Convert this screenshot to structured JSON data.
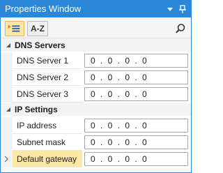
{
  "title": "Properties Window",
  "toolbar": {
    "alpha_label": "A-Z"
  },
  "categories": [
    {
      "label": "DNS Servers",
      "rows": [
        {
          "name": "DNS Server 1",
          "value": "0 . 0 . 0 . 0"
        },
        {
          "name": "DNS Server 2",
          "value": "0 . 0 . 0 . 0"
        },
        {
          "name": "DNS Server 3",
          "value": "0 . 0 . 0 . 0"
        }
      ]
    },
    {
      "label": "IP Settings",
      "rows": [
        {
          "name": "IP address",
          "value": "0 . 0 . 0 . 0"
        },
        {
          "name": "Subnet mask",
          "value": "0 . 0 . 0 . 0"
        },
        {
          "name": "Default gateway",
          "value": "0 . 0 . 0 . 0",
          "selected": true
        }
      ]
    }
  ],
  "colors": {
    "accent": "#2b88d8",
    "selection": "#fde7a6"
  }
}
